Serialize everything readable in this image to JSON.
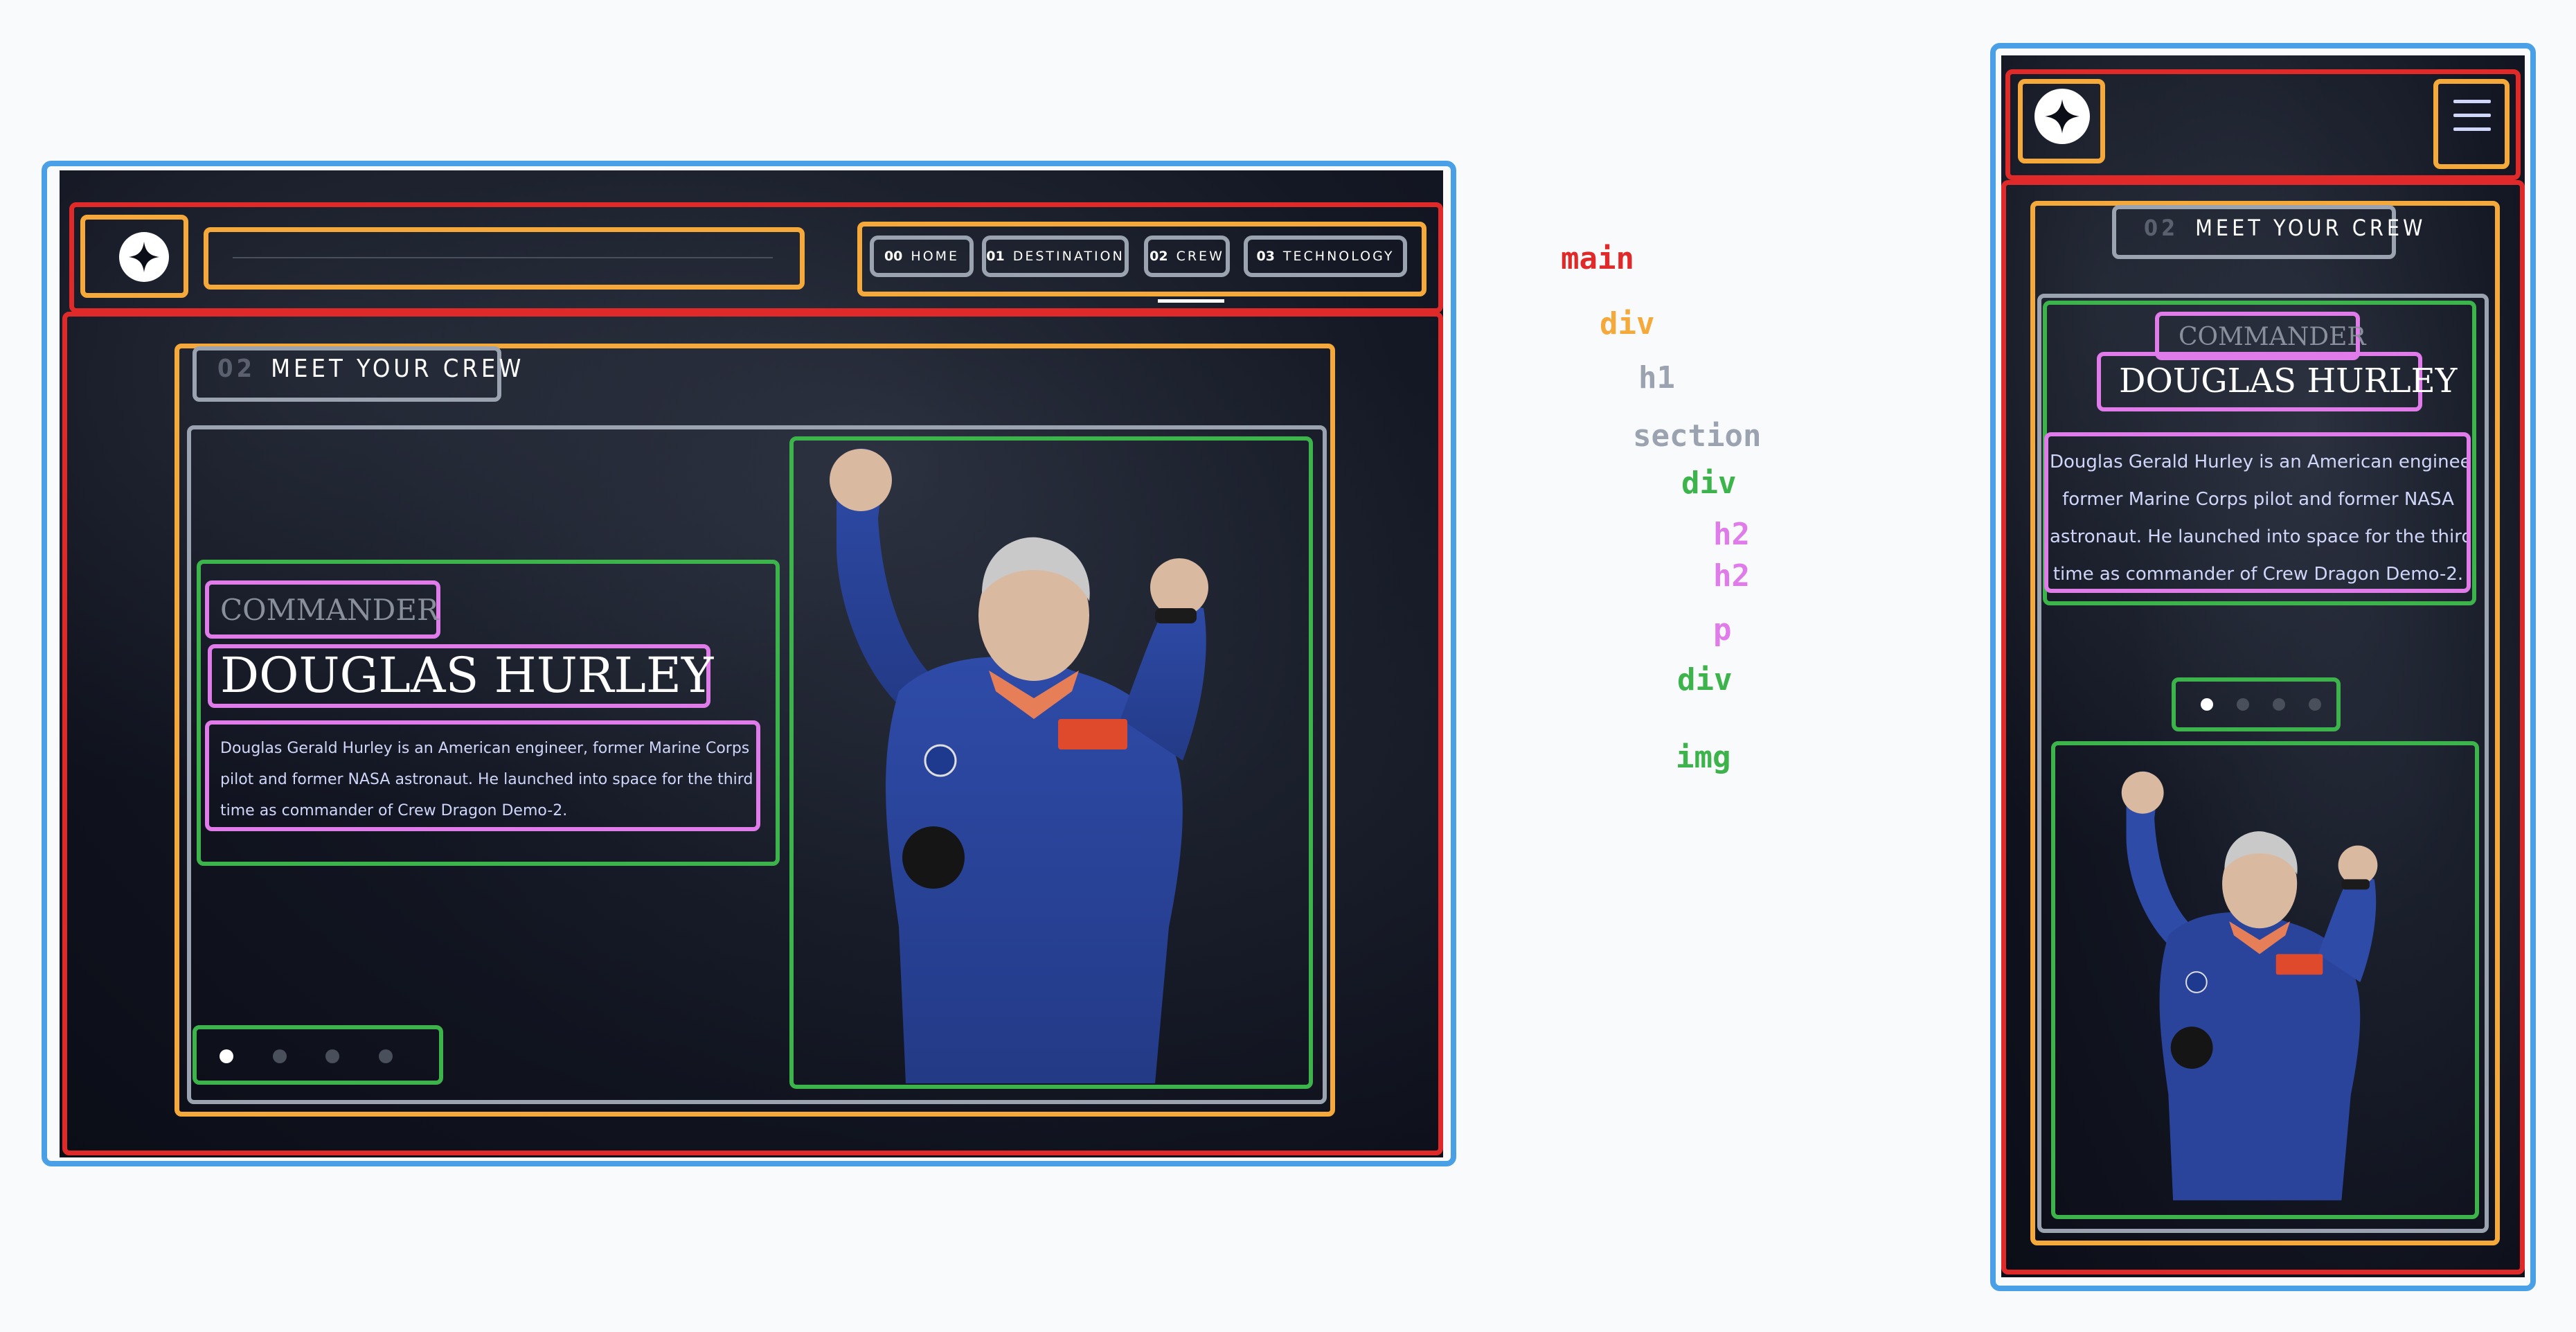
{
  "nav": {
    "items": [
      {
        "num": "00",
        "label": "HOME"
      },
      {
        "num": "01",
        "label": "DESTINATION"
      },
      {
        "num": "02",
        "label": "CREW"
      },
      {
        "num": "03",
        "label": "TECHNOLOGY"
      }
    ]
  },
  "page_heading": {
    "num": "02",
    "label": "MEET YOUR CREW"
  },
  "crew": {
    "role": "COMMANDER",
    "name": "DOUGLAS HURLEY",
    "bio": "Douglas Gerald Hurley is an American engineer, former Marine Corps pilot and former NASA astronaut. He launched into space for the third time as commander of Crew Dragon Demo-2.",
    "bio_lines_desktop": [
      "Douglas Gerald Hurley is an American engineer, former Marine Corps",
      "pilot and former NASA astronaut. He launched into space for the third",
      "time as commander of Crew Dragon Demo-2."
    ],
    "bio_lines_mobile": [
      "Douglas Gerald Hurley is an American engineer",
      "former Marine Corps pilot and former NASA",
      "astronaut. He launched into space for the third",
      "time as commander of Crew Dragon Demo-2."
    ]
  },
  "slider": {
    "count": 4,
    "active_index": 0
  },
  "legend": {
    "items": [
      {
        "label": "main",
        "color": "#e02a2a"
      },
      {
        "label": "div",
        "color": "#f5a93a"
      },
      {
        "label": "h1",
        "color": "#9aa3af"
      },
      {
        "label": "section",
        "color": "#9aa3af"
      },
      {
        "label": "div",
        "color": "#3cb44b"
      },
      {
        "label": "h2",
        "color": "#e07bea"
      },
      {
        "label": "h2",
        "color": "#e07bea"
      },
      {
        "label": "p",
        "color": "#e07bea"
      },
      {
        "label": "div",
        "color": "#3cb44b"
      },
      {
        "label": "img",
        "color": "#3cb44b"
      }
    ]
  },
  "icons": {
    "logo": "star-logo-icon",
    "menu": "hamburger-menu-icon"
  },
  "colors": {
    "main": "#e02a2a",
    "div": "#f5a93a",
    "heading": "#9aa3af",
    "inner_div": "#3cb44b",
    "text": "#e07bea",
    "viewport": "#4aa0e6"
  }
}
